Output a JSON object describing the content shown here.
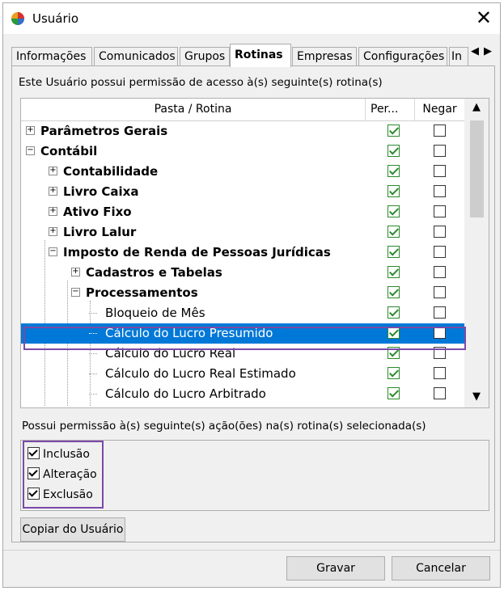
{
  "window": {
    "title": "Usuário"
  },
  "tabs": [
    {
      "label": "Informações",
      "active": false
    },
    {
      "label": "Comunicados",
      "active": false
    },
    {
      "label": "Grupos",
      "active": false
    },
    {
      "label": "Rotinas",
      "active": true
    },
    {
      "label": "Empresas",
      "active": false
    },
    {
      "label": "Configurações",
      "active": false
    },
    {
      "label": "In",
      "active": false
    }
  ],
  "panel": {
    "permission_text": "Este Usuário possui permissão de acesso à(s) seguinte(s) rotina(s)",
    "columns": {
      "folder": "Pasta / Rotina",
      "permit": "Per...",
      "deny": "Negar"
    },
    "rows": [
      {
        "label": "Parâmetros Gerais",
        "bold": true,
        "expander": "+",
        "permit": true,
        "deny": false
      },
      {
        "label": "Contábil",
        "bold": true,
        "expander": "−",
        "permit": true,
        "deny": false
      },
      {
        "label": "Contabilidade",
        "bold": true,
        "expander": "+",
        "permit": true,
        "deny": false
      },
      {
        "label": "Livro Caixa",
        "bold": true,
        "expander": "+",
        "permit": true,
        "deny": false
      },
      {
        "label": "Ativo Fixo",
        "bold": true,
        "expander": "+",
        "permit": true,
        "deny": false
      },
      {
        "label": "Livro Lalur",
        "bold": true,
        "expander": "+",
        "permit": true,
        "deny": false
      },
      {
        "label": "Imposto de Renda de Pessoas Jurídicas",
        "bold": true,
        "expander": "−",
        "permit": true,
        "deny": false
      },
      {
        "label": "Cadastros e Tabelas",
        "bold": true,
        "expander": "+",
        "permit": true,
        "deny": false
      },
      {
        "label": "Processamentos",
        "bold": true,
        "expander": "−",
        "permit": true,
        "deny": false
      },
      {
        "label": "Bloqueio de Mês",
        "bold": false,
        "expander": "",
        "permit": true,
        "deny": false
      },
      {
        "label": "Cálculo do Lucro Presumido",
        "bold": false,
        "expander": "",
        "permit": true,
        "deny": false,
        "selected": true
      },
      {
        "label": "Cálculo do Lucro Real",
        "bold": false,
        "expander": "",
        "permit": true,
        "deny": false
      },
      {
        "label": "Cálculo do Lucro Real Estimado",
        "bold": false,
        "expander": "",
        "permit": true,
        "deny": false
      },
      {
        "label": "Cálculo do Lucro Arbitrado",
        "bold": false,
        "expander": "",
        "permit": true,
        "deny": false
      }
    ],
    "actions_text": "Possui permissão à(s) seguinte(s) ação(ões) na(s) rotina(s) selecionada(s)",
    "actions": [
      {
        "label": "Inclusão",
        "checked": true
      },
      {
        "label": "Alteração",
        "checked": true
      },
      {
        "label": "Exclusão",
        "checked": true
      }
    ],
    "copy_button": "Copiar do Usuário"
  },
  "footer": {
    "save": "Gravar",
    "cancel": "Cancelar"
  },
  "colors": {
    "selection": "#0078d7",
    "check_green": "#2a8a2a",
    "highlight_frame": "#7a4aa8"
  }
}
